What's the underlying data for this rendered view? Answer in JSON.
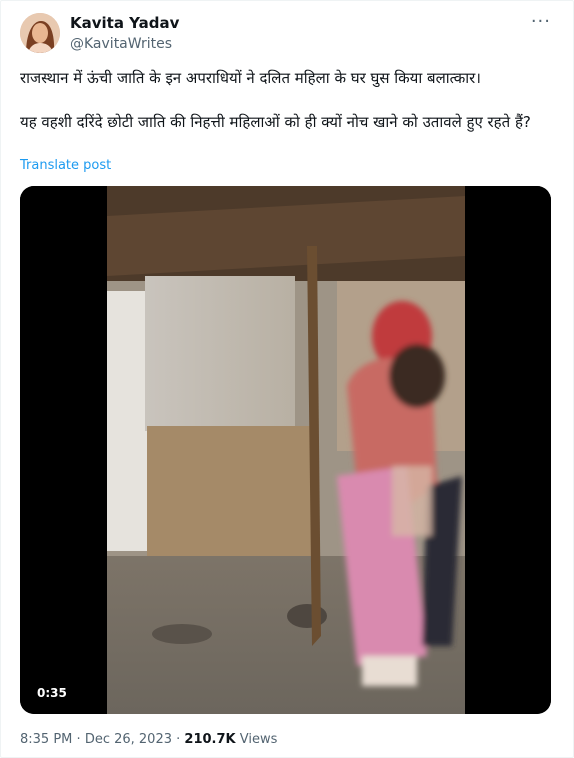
{
  "author": {
    "name": "Kavita Yadav",
    "handle": "@KavitaWrites"
  },
  "more_icon": "more-dots-icon",
  "post": {
    "paragraph1": "राजस्थान में ऊंची जाति के इन अपराधियों ने दलित महिला के घर घुस किया बलात्कार।",
    "paragraph2": "यह वहशी दरिंदे छोटी जाति की निहत्ती महिलाओं को ही क्यों नोच खाने को उतावले हुए रहते हैं?",
    "translate_label": "Translate post"
  },
  "video": {
    "duration": "0:35"
  },
  "meta": {
    "time": "8:35 PM",
    "separator": "·",
    "date": "Dec 26, 2023",
    "views_count": "210.7K",
    "views_label": "Views"
  }
}
